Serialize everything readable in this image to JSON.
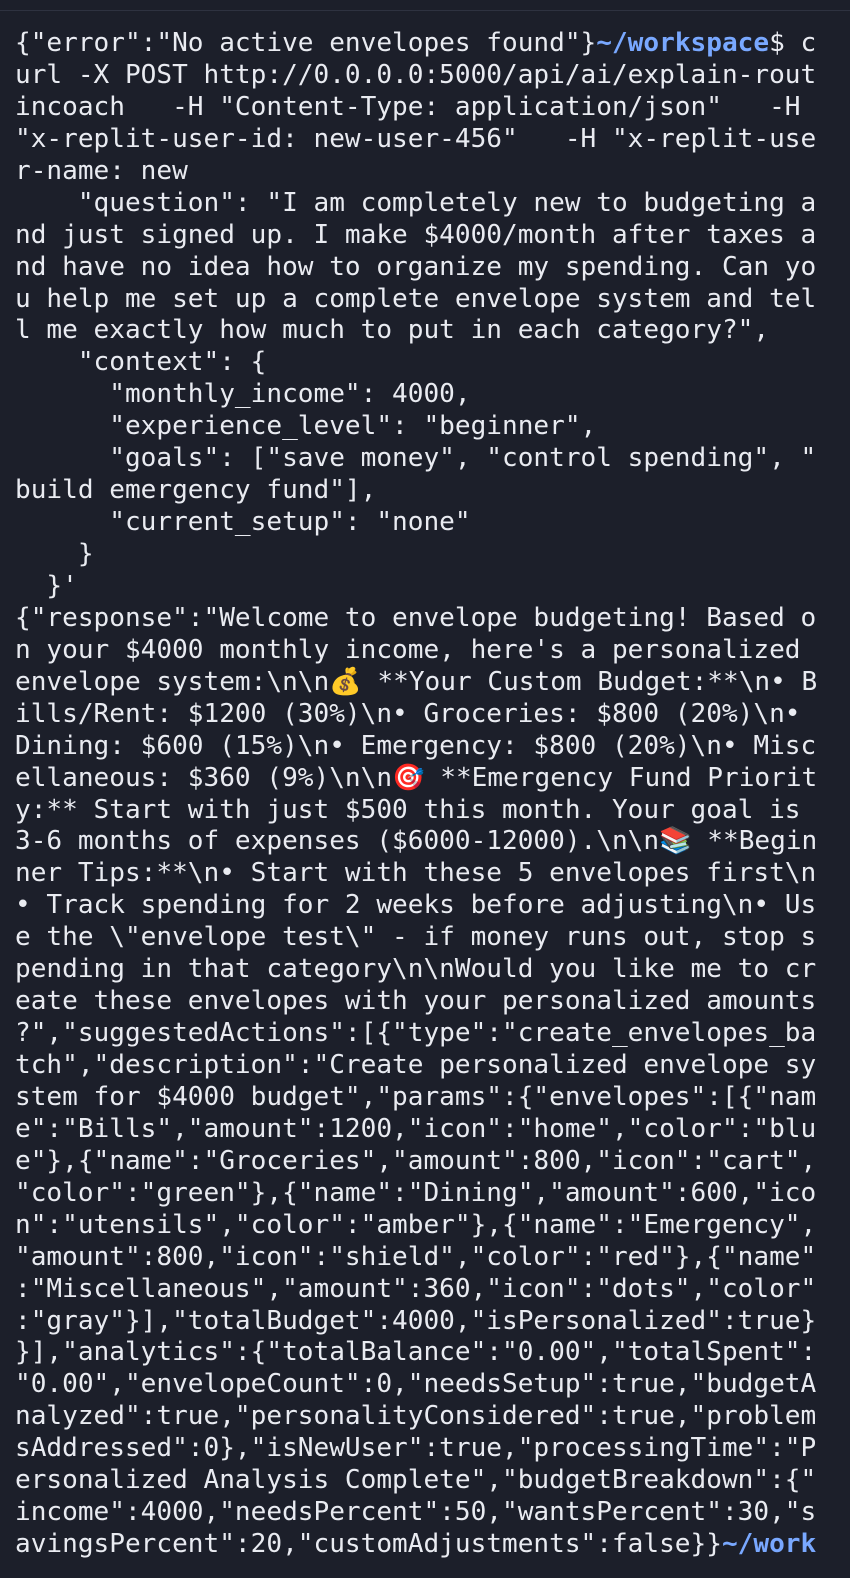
{
  "terminal": {
    "prompt_path": "~/workspace",
    "prompt_symbol": "$ ",
    "final_prompt_path": "~/work",
    "lines": [
      {
        "text": "{\"error\":\"No active envelopes found\"}",
        "path": "~/workspace",
        "after": "$ c"
      },
      {
        "text": "url -X POST http://0.0.0.0:5000/api/ai/explain-rout"
      },
      {
        "text": "incoach   -H \"Content-Type: application/json\"   -H"
      },
      {
        "text": "\"x-replit-user-id: new-user-456\"   -H \"x-replit-use"
      },
      {
        "text": "r-name: new"
      },
      {
        "text": "    \"question\": \"I am completely new to budgeting a"
      },
      {
        "text": "nd just signed up. I make $4000/month after taxes a"
      },
      {
        "text": "nd have no idea how to organize my spending. Can yo"
      },
      {
        "text": "u help me set up a complete envelope system and tel"
      },
      {
        "text": "l me exactly how much to put in each category?\","
      },
      {
        "text": "    \"context\": {"
      },
      {
        "text": "      \"monthly_income\": 4000,"
      },
      {
        "text": "      \"experience_level\": \"beginner\","
      },
      {
        "text": "      \"goals\": [\"save money\", \"control spending\", \""
      },
      {
        "text": "build emergency fund\"],"
      },
      {
        "text": "      \"current_setup\": \"none\""
      },
      {
        "text": "    }"
      },
      {
        "text": "  }'"
      },
      {
        "text": "{\"response\":\"Welcome to envelope budgeting! Based o"
      },
      {
        "text": "n your $4000 monthly income, here's a personalized"
      },
      {
        "text": "envelope system:\\n\\n💰 **Your Custom Budget:**\\n• B"
      },
      {
        "text": "ills/Rent: $1200 (30%)\\n• Groceries: $800 (20%)\\n•"
      },
      {
        "text": "Dining: $600 (15%)\\n• Emergency: $800 (20%)\\n• Misc"
      },
      {
        "text": "ellaneous: $360 (9%)\\n\\n🎯 **Emergency Fund Priorit"
      },
      {
        "text": "y:** Start with just $500 this month. Your goal is"
      },
      {
        "text": "3-6 months of expenses ($6000-12000).\\n\\n📚 **Begin"
      },
      {
        "text": "ner Tips:**\\n• Start with these 5 envelopes first\\n"
      },
      {
        "text": "• Track spending for 2 weeks before adjusting\\n• Us"
      },
      {
        "text": "e the \\\"envelope test\\\" - if money runs out, stop s"
      },
      {
        "text": "pending in that category\\n\\nWould you like me to cr"
      },
      {
        "text": "eate these envelopes with your personalized amounts"
      },
      {
        "text": "?\",\"suggestedActions\":[{\"type\":\"create_envelopes_ba"
      },
      {
        "text": "tch\",\"description\":\"Create personalized envelope sy"
      },
      {
        "text": "stem for $4000 budget\",\"params\":{\"envelopes\":[{\"nam"
      },
      {
        "text": "e\":\"Bills\",\"amount\":1200,\"icon\":\"home\",\"color\":\"blu"
      },
      {
        "text": "e\"},{\"name\":\"Groceries\",\"amount\":800,\"icon\":\"cart\","
      },
      {
        "text": "\"color\":\"green\"},{\"name\":\"Dining\",\"amount\":600,\"ico"
      },
      {
        "text": "n\":\"utensils\",\"color\":\"amber\"},{\"name\":\"Emergency\","
      },
      {
        "text": "\"amount\":800,\"icon\":\"shield\",\"color\":\"red\"},{\"name\""
      },
      {
        "text": ":\"Miscellaneous\",\"amount\":360,\"icon\":\"dots\",\"color\""
      },
      {
        "text": ":\"gray\"}],\"totalBudget\":4000,\"isPersonalized\":true}"
      },
      {
        "text": "}],\"analytics\":{\"totalBalance\":\"0.00\",\"totalSpent\":"
      },
      {
        "text": "\"0.00\",\"envelopeCount\":0,\"needsSetup\":true,\"budgetA"
      },
      {
        "text": "nalyzed\":true,\"personalityConsidered\":true,\"problem"
      },
      {
        "text": "sAddressed\":0},\"isNewUser\":true,\"processingTime\":\"P"
      },
      {
        "text": "ersonalized Analysis Complete\",\"budgetBreakdown\":{\""
      },
      {
        "text": "income\":4000,\"needsPercent\":50,\"wantsPercent\":30,\"s"
      },
      {
        "text": "avingsPercent\":20,\"customAdjustments\":false}}",
        "path": "~/work"
      }
    ]
  },
  "colors": {
    "background": "#1c1f2a",
    "text": "#e9ebf1",
    "prompt_path": "#79a8ff"
  }
}
